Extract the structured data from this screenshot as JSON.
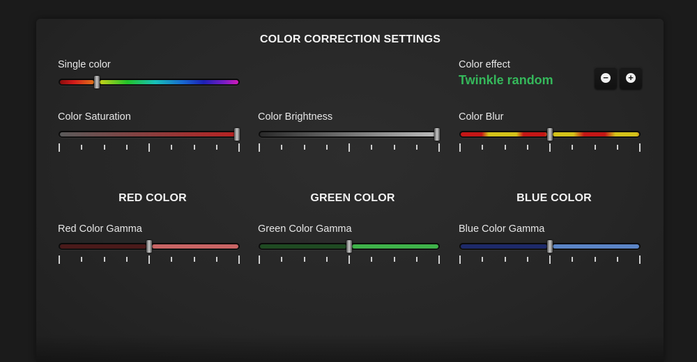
{
  "title": "COLOR CORRECTION SETTINGS",
  "single_color": {
    "label": "Single color",
    "value": 0.21
  },
  "color_effect": {
    "label": "Color effect",
    "value": "Twinkle random",
    "minus_icon": "minus-icon",
    "plus_icon": "plus-icon"
  },
  "saturation": {
    "label": "Color Saturation",
    "value": 1.0
  },
  "brightness": {
    "label": "Color Brightness",
    "value": 1.0
  },
  "blur": {
    "label": "Color Blur",
    "value": 0.5
  },
  "sections": {
    "red": {
      "heading": "RED COLOR",
      "label": "Red Color Gamma",
      "value": 0.5
    },
    "green": {
      "heading": "GREEN COLOR",
      "label": "Green Color Gamma",
      "value": 0.5
    },
    "blue": {
      "heading": "BLUE COLOR",
      "label": "Blue Color Gamma",
      "value": 0.5
    }
  },
  "colors": {
    "accent_green": "#35b85b",
    "saturation_fill": "#b82222",
    "brightness_fill": "#bcbcbc",
    "red_fill": "#c86464",
    "green_fill": "#3fb24a",
    "blue_fill": "#5b84c6"
  }
}
